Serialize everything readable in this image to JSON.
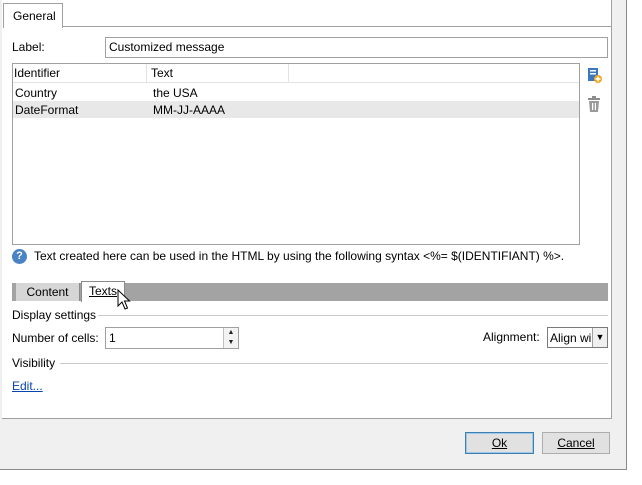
{
  "tabs": {
    "general": "General"
  },
  "label_field": {
    "label": "Label:",
    "value": "Customized message"
  },
  "list": {
    "columns": [
      "Identifier",
      "Text"
    ],
    "rows": [
      {
        "identifier": "Country",
        "text": "the USA"
      },
      {
        "identifier": "DateFormat",
        "text": "MM-JJ-AAAA"
      }
    ],
    "selected_row": 1
  },
  "toolbar": {
    "add_icon": "add-entry-icon",
    "delete_icon": "trash-icon"
  },
  "info": {
    "icon": "help-icon",
    "text": "Text created here can be used in the HTML by using the following syntax <%= $(IDENTIFIANT) %>."
  },
  "subtabs": {
    "content": "Content",
    "texts": "Texts",
    "active": "Texts"
  },
  "display_settings": {
    "title": "Display settings",
    "cells_label": "Number of cells:",
    "cells_value": "1",
    "alignment_label": "Alignment:",
    "alignment_value": "Align wi"
  },
  "visibility": {
    "title": "Visibility",
    "edit_link": "Edit..."
  },
  "buttons": {
    "ok": "Ok",
    "cancel": "Cancel"
  },
  "colors": {
    "subtab_bar": "#a3a3a3",
    "link": "#0645ad",
    "info_icon": "#4a83c4"
  }
}
